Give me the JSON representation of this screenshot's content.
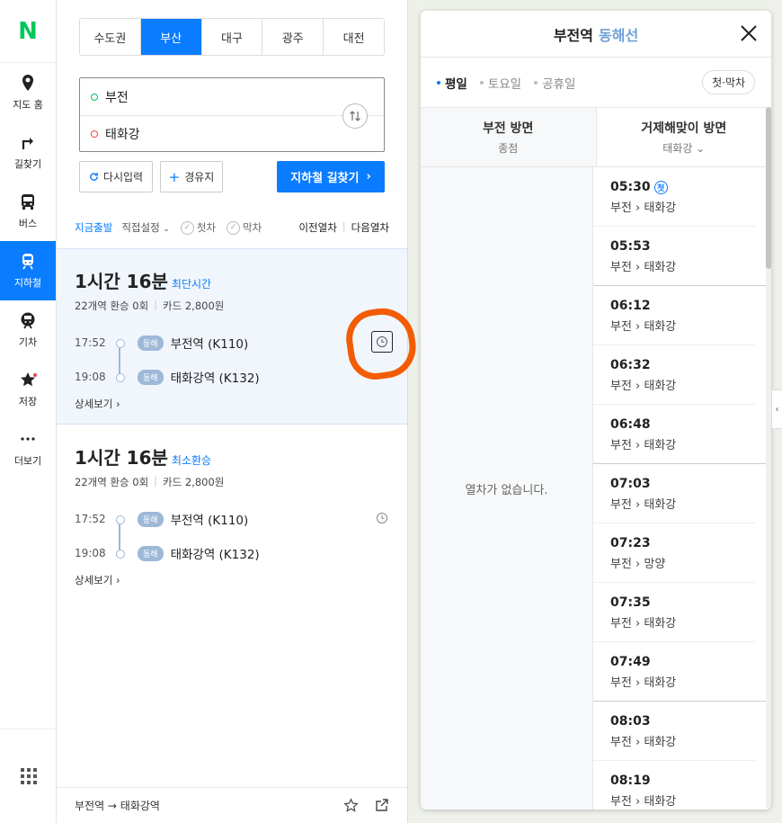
{
  "nav": {
    "logo": "N",
    "items": [
      {
        "label": "지도 홈",
        "icon": "map-pin-icon"
      },
      {
        "label": "길찾기",
        "icon": "directions-icon"
      },
      {
        "label": "버스",
        "icon": "bus-icon"
      },
      {
        "label": "지하철",
        "icon": "subway-icon",
        "active": true
      },
      {
        "label": "기차",
        "icon": "train-icon"
      },
      {
        "label": "저장",
        "icon": "star-icon"
      },
      {
        "label": "더보기",
        "icon": "more-icon"
      }
    ]
  },
  "region_tabs": [
    "수도권",
    "부산",
    "대구",
    "광주",
    "대전"
  ],
  "route": {
    "from": "부전",
    "to": "태화강"
  },
  "buttons": {
    "reset": "다시입력",
    "waypoint": "경유지",
    "search": "지하철 길찾기"
  },
  "options": {
    "depart_now": "지금출발",
    "set_time": "직접설정",
    "first_train": "첫차",
    "last_train": "막차",
    "prev": "이전열차",
    "next": "다음열차"
  },
  "results": [
    {
      "duration": "1시간 16분",
      "tag": "최단시간",
      "stations": "22개역 환승 0회",
      "fare": "카드 2,800원",
      "dep_time": "17:52",
      "dep_line": "동해",
      "dep_station": "부전역 (K110)",
      "arr_time": "19:08",
      "arr_line": "동해",
      "arr_station": "태화강역 (K132)",
      "detail": "상세보기"
    },
    {
      "duration": "1시간 16분",
      "tag": "최소환승",
      "stations": "22개역 환승 0회",
      "fare": "카드 2,800원",
      "dep_time": "17:52",
      "dep_line": "동해",
      "dep_station": "부전역 (K110)",
      "arr_time": "19:08",
      "arr_line": "동해",
      "arr_station": "태화강역 (K132)",
      "detail": "상세보기"
    }
  ],
  "footer": {
    "route": "부전역 → 태화강역"
  },
  "timetable": {
    "station": "부전역",
    "line": "동해선",
    "days": [
      "평일",
      "토요일",
      "공휴일"
    ],
    "first_last": "첫·막차",
    "left_col": {
      "name": "부전 방면",
      "sub": "종점",
      "empty": "열차가 없습니다."
    },
    "right_col": {
      "name": "거제해맞이 방면",
      "sub": "태화강"
    },
    "first_badge": "첫",
    "rows": [
      {
        "time": "05:30",
        "dir": "부전 › 태화강"
      },
      {
        "time": "05:53",
        "dir": "부전 › 태화강"
      },
      {
        "time": "06:12",
        "dir": "부전 › 태화강"
      },
      {
        "time": "06:32",
        "dir": "부전 › 태화강"
      },
      {
        "time": "06:48",
        "dir": "부전 › 태화강"
      },
      {
        "time": "07:03",
        "dir": "부전 › 태화강"
      },
      {
        "time": "07:23",
        "dir": "부전 › 망양"
      },
      {
        "time": "07:35",
        "dir": "부전 › 태화강"
      },
      {
        "time": "07:49",
        "dir": "부전 › 태화강"
      },
      {
        "time": "08:03",
        "dir": "부전 › 태화강"
      },
      {
        "time": "08:19",
        "dir": "부전 › 태화강"
      }
    ]
  },
  "colors": {
    "accent": "#0a7cff",
    "brand": "#03c75a",
    "annotation": "#f25c05"
  }
}
